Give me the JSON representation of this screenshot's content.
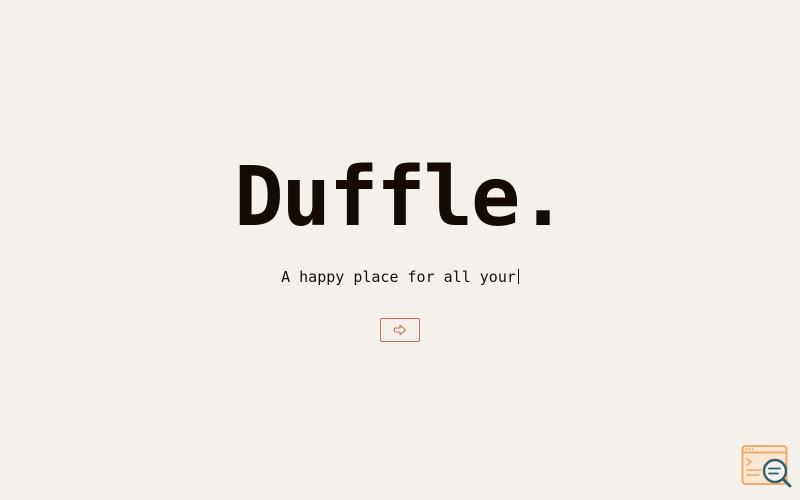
{
  "hero": {
    "title": "Duffle.",
    "tagline": "A happy place for all your"
  },
  "enter_button": {
    "icon": "arrow-right-icon"
  },
  "corner_logo": {
    "icon": "browser-search-icon"
  },
  "colors": {
    "background": "#f4f1ec",
    "text": "#140b07",
    "accent": "#c2735a",
    "logo_orange": "#f0a868",
    "logo_teal": "#2e5f6b"
  }
}
